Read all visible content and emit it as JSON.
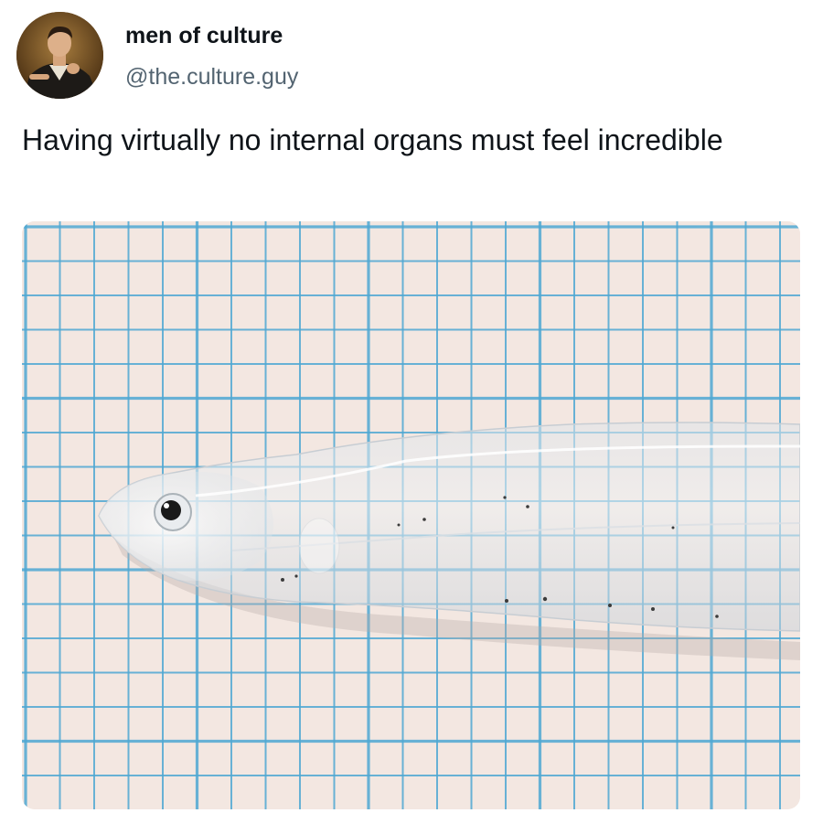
{
  "tweet": {
    "display_name": "men of culture",
    "handle": "@the.culture.guy",
    "text": "Having virtually no internal organs must feel incredible"
  },
  "media": {
    "subject": "translucent-glass-eel-on-graph-paper",
    "grid_color": "#4fa8d3",
    "paper_color": "#f3e7e1"
  },
  "icons": {
    "avatar": "portrait-icon"
  }
}
